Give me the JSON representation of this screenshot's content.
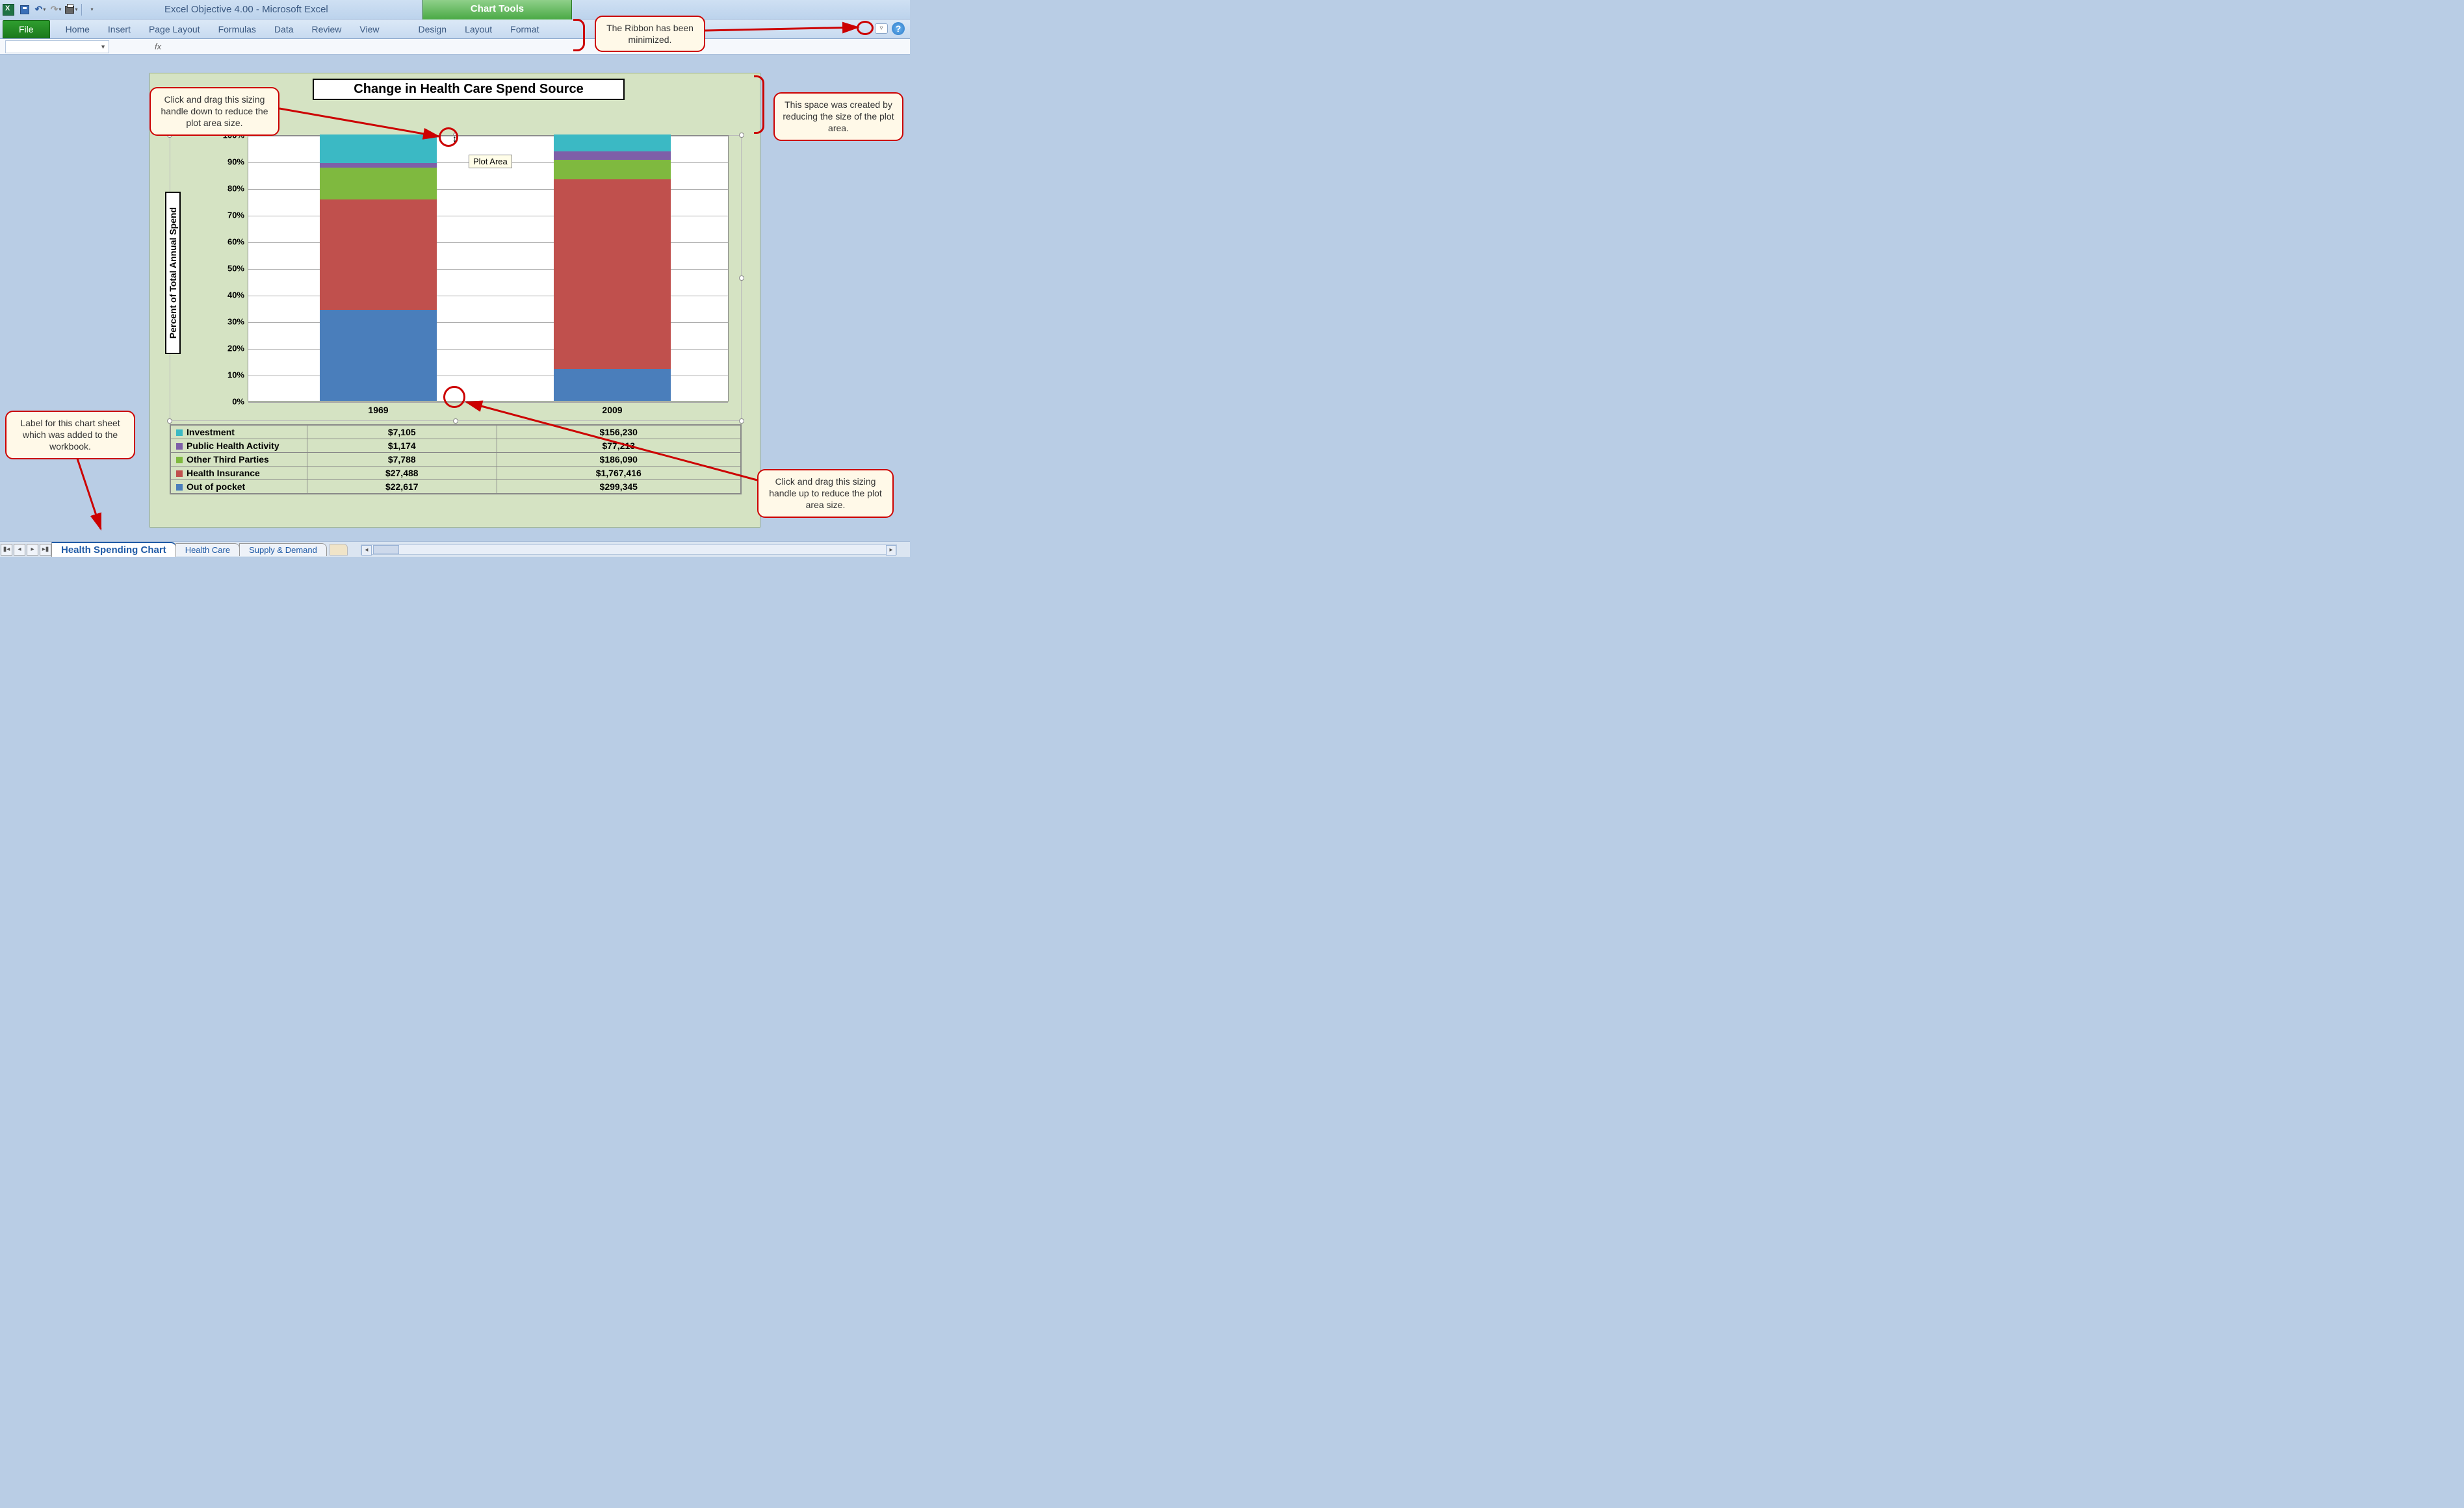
{
  "window": {
    "title": "Excel Objective 4.00  -  Microsoft Excel"
  },
  "chart_tools": {
    "label": "Chart Tools"
  },
  "ribbon": {
    "file": "File",
    "tabs": [
      "Home",
      "Insert",
      "Page Layout",
      "Formulas",
      "Data",
      "Review",
      "View"
    ],
    "contextual": [
      "Design",
      "Layout",
      "Format"
    ]
  },
  "formula_bar": {
    "fx": "fx"
  },
  "chart": {
    "title": "Change in Health Care Spend Source",
    "y_axis_title": "Percent of Total Annual Spend",
    "tooltip": "Plot Area"
  },
  "chart_data": {
    "type": "bar",
    "stacked": true,
    "percent": true,
    "ylim": [
      0,
      100
    ],
    "y_ticks": [
      "0%",
      "10%",
      "20%",
      "30%",
      "40%",
      "50%",
      "60%",
      "70%",
      "80%",
      "90%",
      "100%"
    ],
    "categories": [
      "1969",
      "2009"
    ],
    "series": [
      {
        "name": "Investment",
        "color": "#3bb9c4",
        "values": [
          7105,
          156230
        ],
        "pct": [
          10.7,
          6.3
        ]
      },
      {
        "name": "Public Health Activity",
        "color": "#7e5fa8",
        "values": [
          1174,
          77213
        ],
        "pct": [
          1.8,
          3.1
        ]
      },
      {
        "name": "Other Third Parties",
        "color": "#7fb93f",
        "values": [
          7788,
          186090
        ],
        "pct": [
          11.8,
          7.5
        ]
      },
      {
        "name": "Health Insurance",
        "color": "#c0504d",
        "values": [
          27488,
          1767416
        ],
        "pct": [
          41.5,
          71.1
        ]
      },
      {
        "name": "Out of pocket",
        "color": "#4a7ebb",
        "values": [
          22617,
          299345
        ],
        "pct": [
          34.2,
          12.0
        ]
      }
    ],
    "table_values": {
      "Investment": [
        "$7,105",
        "$156,230"
      ],
      "Public Health Activity": [
        "$1,174",
        "$77,213"
      ],
      "Other Third Parties": [
        "$7,788",
        "$186,090"
      ],
      "Health Insurance": [
        "$27,488",
        "$1,767,416"
      ],
      "Out of pocket": [
        "$22,617",
        "$299,345"
      ]
    }
  },
  "callouts": {
    "ribbon_min": "The Ribbon has been minimized.",
    "top_handle": "Click and drag this sizing handle down to reduce the plot area size.",
    "right_space": "This space was created by reducing the size of the plot area.",
    "bottom_handle": "Click and drag this sizing handle up to reduce the plot area size.",
    "sheet_label": "Label for this chart sheet which was added to the workbook."
  },
  "sheets": {
    "active": "Health Spending Chart",
    "others": [
      "Health Care",
      "Supply & Demand"
    ]
  }
}
